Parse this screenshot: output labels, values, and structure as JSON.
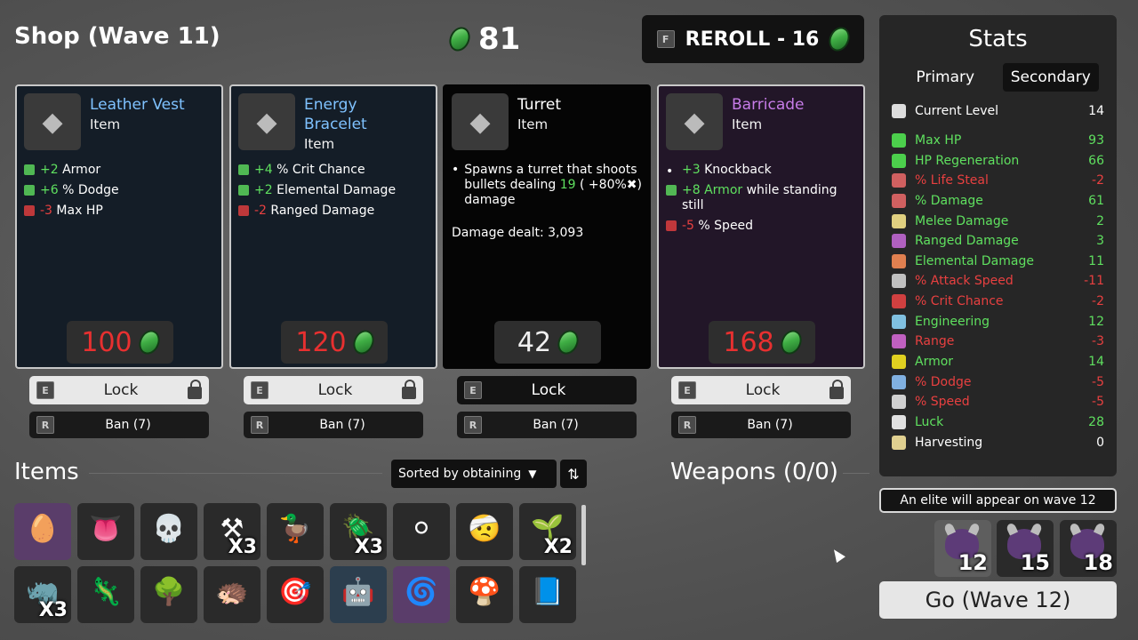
{
  "header": {
    "title": "Shop (Wave 11)",
    "materials": "81",
    "reroll_label": "REROLL - 16",
    "reroll_key": "F"
  },
  "colors": {
    "positive": "#5fe05f",
    "negative": "#e84040",
    "rare_blue": "#7fc2ff",
    "legendary_purple": "#c77ce8"
  },
  "shop": [
    {
      "name": "Leather Vest",
      "name_color": "#7fc2ff",
      "type": "Item",
      "icon": "leather-vest-icon",
      "effects": [
        {
          "value": "+2",
          "value_color": "#5fe05f",
          "text": "Armor",
          "icon": "armor-icon"
        },
        {
          "value": "+6",
          "value_color": "#5fe05f",
          "text": "% Dodge",
          "icon": "dodge-icon"
        },
        {
          "value": "-3",
          "value_color": "#e84040",
          "text": "Max HP",
          "icon": "heart-icon"
        }
      ],
      "price": "100",
      "price_color": "#e83030",
      "lock": "Lock",
      "ban": "Ban (7)"
    },
    {
      "name": "Energy Bracelet",
      "name_color": "#7fc2ff",
      "type": "Item",
      "icon": "bracelet-icon",
      "effects": [
        {
          "value": "+4",
          "value_color": "#5fe05f",
          "text": "% Crit Chance",
          "icon": "crit-icon"
        },
        {
          "value": "+2",
          "value_color": "#5fe05f",
          "text": "Elemental Damage",
          "icon": "flame-icon"
        },
        {
          "value": "-2",
          "value_color": "#e84040",
          "text": "Ranged Damage",
          "icon": "ranged-icon"
        }
      ],
      "price": "120",
      "price_color": "#e83030",
      "lock": "Lock",
      "ban": "Ban (7)"
    },
    {
      "name": "Turret",
      "name_color": "#ffffff",
      "type": "Item",
      "icon": "turret-icon",
      "description": "Spawns a turret that shoots bullets dealing",
      "description_value": "19",
      "description_tail": "( +80%✖) damage",
      "extra": "Damage dealt: 3,093",
      "price": "42",
      "price_color": "#f0f0f0",
      "lock": "Lock",
      "ban": "Ban (7)"
    },
    {
      "name": "Barricade",
      "name_color": "#c77ce8",
      "type": "Item",
      "icon": "barricade-icon",
      "effects": [
        {
          "value": "+3",
          "value_color": "#5fe05f",
          "text": "Knockback",
          "icon": "bullet"
        },
        {
          "value": "+8 Armor",
          "value_color": "#5fe05f",
          "text": "while standing still",
          "icon": "armor-icon"
        },
        {
          "value": "-5",
          "value_color": "#e84040",
          "text": "% Speed",
          "icon": "speed-icon"
        }
      ],
      "price": "168",
      "price_color": "#e83030",
      "lock": "Lock",
      "ban": "Ban (7)"
    }
  ],
  "keys": {
    "lock": "E",
    "ban": "R"
  },
  "items_section": {
    "title": "Items",
    "sort_label": "Sorted by obtaining",
    "grid": [
      {
        "icon": "alien-egg-icon",
        "glyph": "🥚",
        "qty": "",
        "bg": "purple"
      },
      {
        "icon": "tongue-icon",
        "glyph": "👅",
        "qty": "",
        "bg": ""
      },
      {
        "icon": "skull-icon",
        "glyph": "💀",
        "qty": "",
        "bg": ""
      },
      {
        "icon": "scythe-icon",
        "glyph": "⚒",
        "qty": "X3",
        "bg": ""
      },
      {
        "icon": "duck-icon",
        "glyph": "🦆",
        "qty": "",
        "bg": ""
      },
      {
        "icon": "bug-icon",
        "glyph": "🪲",
        "qty": "X3",
        "bg": ""
      },
      {
        "icon": "snowball-icon",
        "glyph": "⚪",
        "qty": "",
        "bg": ""
      },
      {
        "icon": "mummy-icon",
        "glyph": "🤕",
        "qty": "",
        "bg": ""
      },
      {
        "icon": "sprout-icon",
        "glyph": "🌱",
        "qty": "X2",
        "bg": ""
      },
      {
        "icon": "horn-icon",
        "glyph": "🦏",
        "qty": "X3",
        "bg": ""
      },
      {
        "icon": "lizard-icon",
        "glyph": "🦎",
        "qty": "",
        "bg": ""
      },
      {
        "icon": "tree-icon",
        "glyph": "🌳",
        "qty": "",
        "bg": ""
      },
      {
        "icon": "hedgehog-icon",
        "glyph": "🦔",
        "qty": "",
        "bg": ""
      },
      {
        "icon": "turret-icon",
        "glyph": "🎯",
        "qty": "",
        "bg": ""
      },
      {
        "icon": "robot-icon",
        "glyph": "🤖",
        "qty": "",
        "bg": "blue"
      },
      {
        "icon": "spring-icon",
        "glyph": "🌀",
        "qty": "",
        "bg": "purple"
      },
      {
        "icon": "mushroom-icon",
        "glyph": "🍄",
        "qty": "",
        "bg": ""
      },
      {
        "icon": "book-icon",
        "glyph": "📘",
        "qty": "",
        "bg": ""
      }
    ]
  },
  "weapons_title": "Weapons (0/0)",
  "stats": {
    "title": "Stats",
    "tabs": [
      "Primary",
      "Secondary"
    ],
    "rows": [
      {
        "name": "Current Level",
        "value": "14",
        "color": "#ffffff",
        "icon_color": "#dddddd"
      },
      {
        "name": "Max HP",
        "value": "93",
        "color": "#5fe05f",
        "icon_color": "#4ccf4c"
      },
      {
        "name": "HP Regeneration",
        "value": "66",
        "color": "#5fe05f",
        "icon_color": "#4ccf4c"
      },
      {
        "name": "% Life Steal",
        "value": "-2",
        "color": "#e84040",
        "icon_color": "#d06060"
      },
      {
        "name": "% Damage",
        "value": "61",
        "color": "#5fe05f",
        "icon_color": "#d06060"
      },
      {
        "name": "Melee Damage",
        "value": "2",
        "color": "#5fe05f",
        "icon_color": "#e0d080"
      },
      {
        "name": "Ranged Damage",
        "value": "3",
        "color": "#5fe05f",
        "icon_color": "#b060c0"
      },
      {
        "name": "Elemental Damage",
        "value": "11",
        "color": "#5fe05f",
        "icon_color": "#e08050"
      },
      {
        "name": "% Attack Speed",
        "value": "-11",
        "color": "#e84040",
        "icon_color": "#c0c0c0"
      },
      {
        "name": "% Crit Chance",
        "value": "-2",
        "color": "#e84040",
        "icon_color": "#d04040"
      },
      {
        "name": "Engineering",
        "value": "12",
        "color": "#5fe05f",
        "icon_color": "#80c0e0"
      },
      {
        "name": "Range",
        "value": "-3",
        "color": "#e84040",
        "icon_color": "#c060c0"
      },
      {
        "name": "Armor",
        "value": "14",
        "color": "#5fe05f",
        "icon_color": "#e0d020"
      },
      {
        "name": "% Dodge",
        "value": "-5",
        "color": "#e84040",
        "icon_color": "#80b0e0"
      },
      {
        "name": "% Speed",
        "value": "-5",
        "color": "#e84040",
        "icon_color": "#d0d0d0"
      },
      {
        "name": "Luck",
        "value": "28",
        "color": "#5fe05f",
        "icon_color": "#e0e0e0"
      },
      {
        "name": "Harvesting",
        "value": "0",
        "color": "#ffffff",
        "icon_color": "#e0d090"
      }
    ]
  },
  "elite_notice": "An elite will appear on wave 12",
  "enemies": [
    {
      "wave": "12",
      "selected": true
    },
    {
      "wave": "15",
      "selected": false
    },
    {
      "wave": "18",
      "selected": false
    }
  ],
  "go_label": "Go (Wave 12)"
}
